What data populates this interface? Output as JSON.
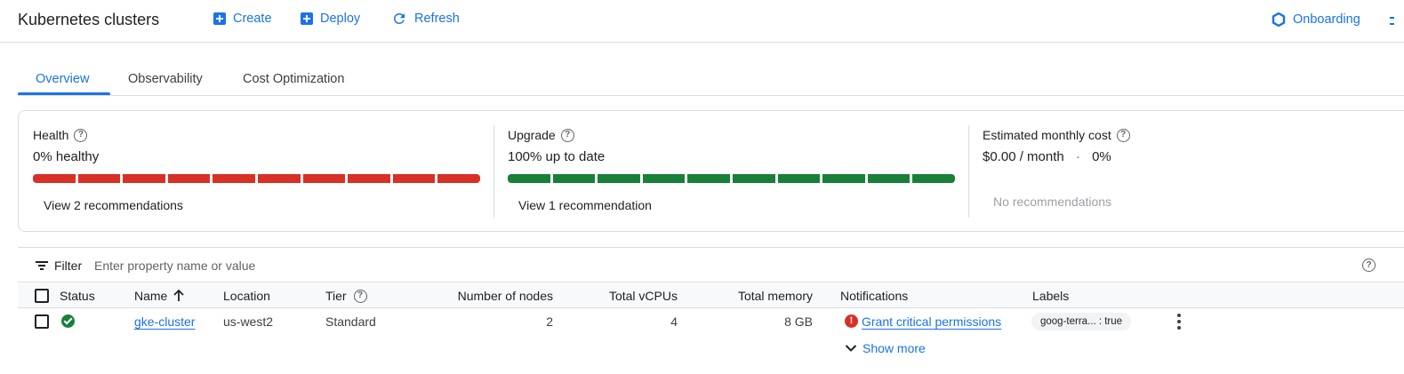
{
  "header": {
    "title": "Kubernetes clusters",
    "create_label": "Create",
    "deploy_label": "Deploy",
    "refresh_label": "Refresh",
    "onboarding_label": "Onboarding"
  },
  "tabs": [
    {
      "label": "Overview",
      "active": true
    },
    {
      "label": "Observability",
      "active": false
    },
    {
      "label": "Cost Optimization",
      "active": false
    }
  ],
  "summary": {
    "health": {
      "title": "Health",
      "value": "0% healthy",
      "healthy_fraction": 0,
      "segments": 10,
      "bar_color": "#d93025",
      "link": "View 2 recommendations"
    },
    "upgrade": {
      "title": "Upgrade",
      "value": "100% up to date",
      "up_to_date_fraction": 1,
      "segments": 10,
      "bar_color": "#188038",
      "link": "View 1 recommendation"
    },
    "cost": {
      "title": "Estimated monthly cost",
      "value": "$0.00 / month",
      "separator": "·",
      "percent": "0%",
      "note": "No recommendations"
    }
  },
  "filter": {
    "label": "Filter",
    "placeholder": "Enter property name or value"
  },
  "table": {
    "columns": {
      "status": "Status",
      "name": "Name",
      "location": "Location",
      "tier": "Tier",
      "nodes": "Number of nodes",
      "vcpus": "Total vCPUs",
      "memory": "Total memory",
      "notifications": "Notifications",
      "labels": "Labels"
    },
    "rows": [
      {
        "status": "ok",
        "name": "gke-cluster",
        "location": "us-west2",
        "tier": "Standard",
        "nodes": "2",
        "vcpus": "4",
        "memory": "8 GB",
        "notification": "Grant critical permissions",
        "label_chip": "goog-terra... : true",
        "show_more": "Show more"
      }
    ]
  },
  "colors": {
    "accent": "#1a73e8",
    "error": "#d93025",
    "success": "#188038"
  }
}
